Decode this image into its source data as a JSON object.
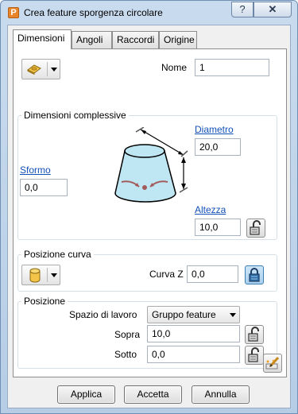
{
  "window": {
    "title": "Crea feature sporgenza circolare",
    "app_icon_letter": "P",
    "help_label": "?",
    "close_label": "✕"
  },
  "tabs": [
    {
      "label": "Dimensioni"
    },
    {
      "label": "Angoli"
    },
    {
      "label": "Raccordi"
    },
    {
      "label": "Origine"
    }
  ],
  "header": {
    "name_label": "Nome",
    "name_value": "1"
  },
  "overall": {
    "title": "Dimensioni complessive",
    "diameter_label": "Diametro",
    "diameter_value": "20,0",
    "draft_label": "Sformo",
    "draft_value": "0,0",
    "height_label": "Altezza",
    "height_value": "10,0"
  },
  "curve": {
    "title": "Posizione curva",
    "curve_z_label": "Curva Z",
    "curve_z_value": "0,0"
  },
  "position": {
    "title": "Posizione",
    "workspace_label": "Spazio di lavoro",
    "workspace_value": "Gruppo feature",
    "above_label": "Sopra",
    "above_value": "10,0",
    "below_label": "Sotto",
    "below_value": "0,0"
  },
  "buttons": {
    "apply": "Applica",
    "accept": "Accetta",
    "cancel": "Annulla"
  },
  "colors": {
    "link": "#1150b8",
    "boss_fill": "#bfe6f3",
    "frame": "#b7cde6"
  }
}
